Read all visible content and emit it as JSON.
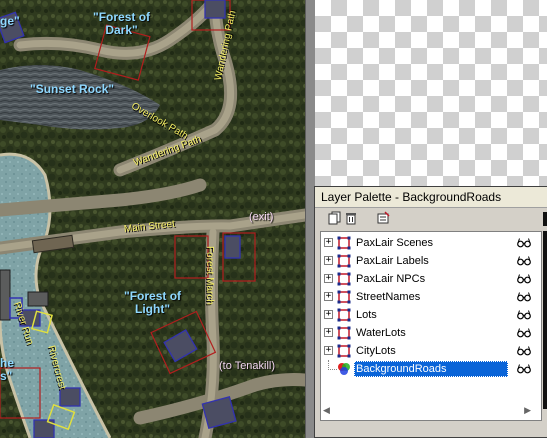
{
  "map": {
    "labels": {
      "forest_dark": "\"Forest of\nDark\"",
      "sunset_rock": "\"Sunset Rock\"",
      "forest_light": "\"Forest of\nLight\"",
      "edge_top": "ge\"",
      "edge_bottom": "he\ns\"",
      "wandering_path_top": "Wandering Path",
      "overlook_path": "Overlook Path",
      "wandering_path_mid": "Wandering Path",
      "main_street": "Main Street",
      "forest_march": "Forest March",
      "river_run": "River Run",
      "rivercrest": "Rivercrest",
      "exit": "(exit)",
      "tenakill": "(to Tenakill)"
    }
  },
  "palette": {
    "title": "Layer Palette - BackgroundRoads",
    "toolbar": {
      "new_icon": "new-layer-icon",
      "delete_icon": "trash-icon",
      "props_icon": "layer-properties-icon"
    },
    "layers": [
      {
        "name": "PaxLair Scenes",
        "expandable": true,
        "type": "vector",
        "visible": true
      },
      {
        "name": "PaxLair Labels",
        "expandable": true,
        "type": "vector",
        "visible": true
      },
      {
        "name": "PaxLair NPCs",
        "expandable": true,
        "type": "vector",
        "visible": true
      },
      {
        "name": "StreetNames",
        "expandable": true,
        "type": "vector",
        "visible": true
      },
      {
        "name": "Lots",
        "expandable": true,
        "type": "vector",
        "visible": true
      },
      {
        "name": "WaterLots",
        "expandable": true,
        "type": "vector",
        "visible": true
      },
      {
        "name": "CityLots",
        "expandable": true,
        "type": "vector",
        "visible": true
      },
      {
        "name": "BackgroundRoads",
        "expandable": false,
        "type": "raster",
        "visible": true,
        "selected": true
      }
    ],
    "colors": {
      "selection": "#0a64d8",
      "vector_icon": "#c0182a"
    }
  }
}
